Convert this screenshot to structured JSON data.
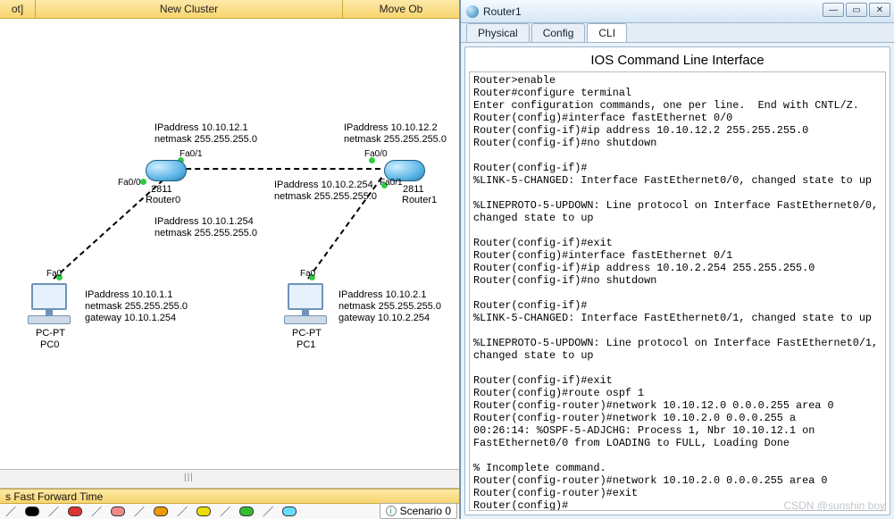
{
  "left": {
    "toolbar": {
      "left": "ot]",
      "mid": "New Cluster",
      "right": "Move Ob"
    },
    "labels": {
      "r0_ip": "IPaddress 10.10.12.1\nnetmask 255.255.255.0",
      "r1_ip": "IPaddress 10.10.12.2\nnetmask 255.255.255.0",
      "r0_fa01": "Fa0/1",
      "r1_fa00": "Fa0/0",
      "r0_fa00": "Fa0/0",
      "r1_fa01": "Fa0/1",
      "r0_model": "2811",
      "r1_model": "2811",
      "r0_name": "Router0",
      "r1_name": "Router1",
      "r1_lan": "IPaddress 10.10.2.254\nnetmask 255.255.255.0",
      "r0_lan": "IPaddress 10.10.1.254\nnetmask 255.255.255.0",
      "pc0_fa0": "Fa0",
      "pc1_fa0": "Fa0",
      "pc0_cfg": "IPaddress 10.10.1.1\nnetmask 255.255.255.0\ngateway 10.10.1.254",
      "pc1_cfg": "IPaddress 10.10.2.1\nnetmask 255.255.255.0\ngateway 10.10.2.254",
      "pc0_type": "PC-PT",
      "pc0_name": "PC0",
      "pc1_type": "PC-PT",
      "pc1_name": "PC1"
    },
    "fft": "s  Fast Forward Time",
    "scenario": "Scenario 0"
  },
  "right": {
    "title": "Router1",
    "tabs": {
      "physical": "Physical",
      "config": "Config",
      "cli": "CLI"
    },
    "cli_title": "IOS Command Line Interface",
    "cli": "Router>enable\nRouter#configure terminal\nEnter configuration commands, one per line.  End with CNTL/Z.\nRouter(config)#interface fastEthernet 0/0\nRouter(config-if)#ip address 10.10.12.2 255.255.255.0\nRouter(config-if)#no shutdown\n\nRouter(config-if)#\n%LINK-5-CHANGED: Interface FastEthernet0/0, changed state to up\n\n%LINEPROTO-5-UPDOWN: Line protocol on Interface FastEthernet0/0,\nchanged state to up\n\nRouter(config-if)#exit\nRouter(config)#interface fastEthernet 0/1\nRouter(config-if)#ip address 10.10.2.254 255.255.255.0\nRouter(config-if)#no shutdown\n\nRouter(config-if)#\n%LINK-5-CHANGED: Interface FastEthernet0/1, changed state to up\n\n%LINEPROTO-5-UPDOWN: Line protocol on Interface FastEthernet0/1,\nchanged state to up\n\nRouter(config-if)#exit\nRouter(config)#route ospf 1\nRouter(config-router)#network 10.10.12.0 0.0.0.255 area 0\nRouter(config-router)#network 10.10.2.0 0.0.0.255 a\n00:26:14: %OSPF-5-ADJCHG: Process 1, Nbr 10.10.12.1 on\nFastEthernet0/0 from LOADING to FULL, Loading Done\n\n% Incomplete command.\nRouter(config-router)#network 10.10.2.0 0.0.0.255 area 0\nRouter(config-router)#exit\nRouter(config)#"
  },
  "watermark": "CSDN @sunshin boy"
}
